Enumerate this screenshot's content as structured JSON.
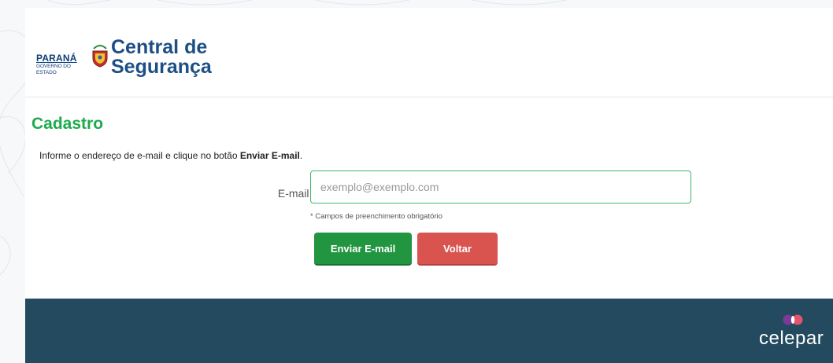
{
  "brand": {
    "state_name": "PARANÁ",
    "state_subtitle": "GOVERNO DO ESTADO",
    "app_title_line1": "Central de",
    "app_title_line2": "Segurança",
    "title_color": "#1d4f86"
  },
  "page": {
    "title": "Cadastro",
    "title_color": "#1eaa4e",
    "instruction_prefix": "Informe o endereço de e-mail e clique no botão ",
    "instruction_bold": "Enviar E-mail",
    "instruction_suffix": "."
  },
  "form": {
    "email_label": "E-mail",
    "required_marker": "*",
    "email_value": "",
    "email_placeholder": "exemplo@exemplo.com",
    "required_note": "* Campos de preenchimento obrigatório"
  },
  "buttons": {
    "send_label": "Enviar E-mail",
    "send_color": "#229540",
    "back_label": "Voltar",
    "back_color": "#d9534f"
  },
  "footer": {
    "brand": "celepar",
    "background": "#244a5f"
  }
}
